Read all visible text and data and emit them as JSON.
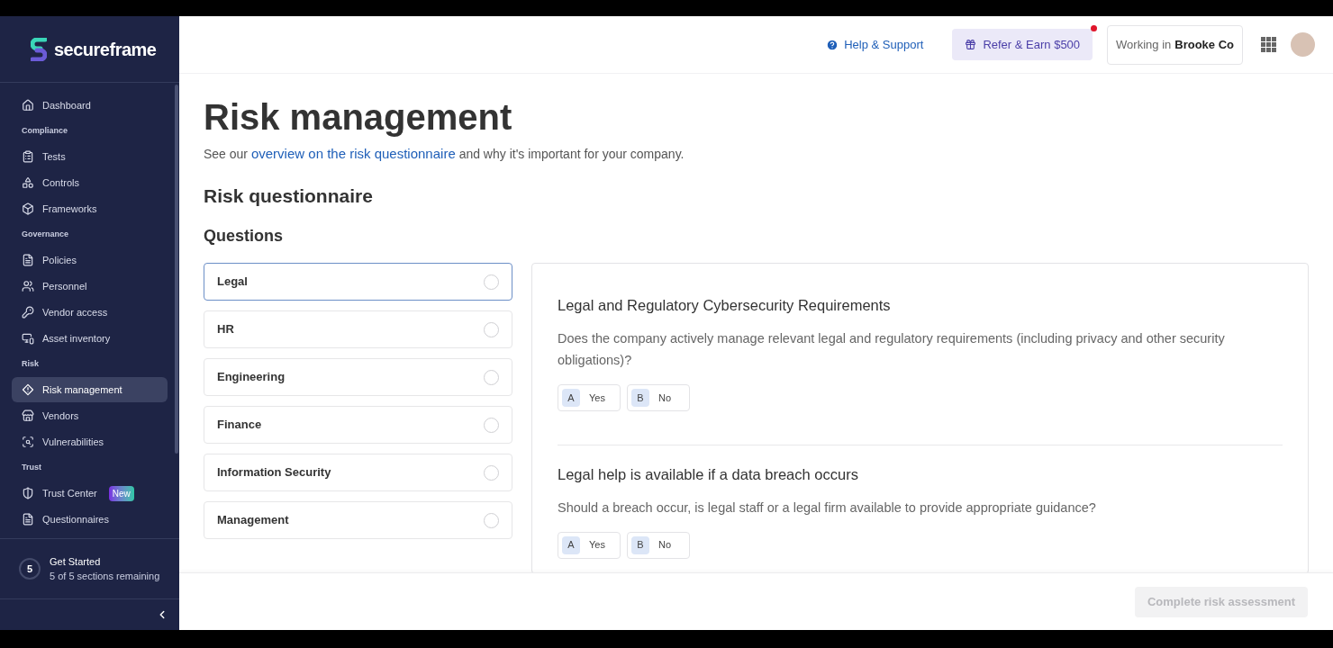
{
  "sidebar": {
    "brand": "secureframe",
    "items": [
      {
        "kind": "item",
        "label": "Dashboard",
        "selected": false
      },
      {
        "kind": "section",
        "label": "Compliance"
      },
      {
        "kind": "item",
        "label": "Tests",
        "selected": false
      },
      {
        "kind": "item",
        "label": "Controls",
        "selected": false
      },
      {
        "kind": "item",
        "label": "Frameworks",
        "selected": false
      },
      {
        "kind": "section",
        "label": "Governance"
      },
      {
        "kind": "item",
        "label": "Policies",
        "selected": false
      },
      {
        "kind": "item",
        "label": "Personnel",
        "selected": false
      },
      {
        "kind": "item",
        "label": "Vendor access",
        "selected": false
      },
      {
        "kind": "item",
        "label": "Asset inventory",
        "selected": false
      },
      {
        "kind": "section",
        "label": "Risk"
      },
      {
        "kind": "item",
        "label": "Risk management",
        "selected": true
      },
      {
        "kind": "item",
        "label": "Vendors",
        "selected": false
      },
      {
        "kind": "item",
        "label": "Vulnerabilities",
        "selected": false
      },
      {
        "kind": "section",
        "label": "Trust"
      },
      {
        "kind": "item",
        "label": "Trust Center",
        "selected": false,
        "badge": "New"
      },
      {
        "kind": "item",
        "label": "Questionnaires",
        "selected": false
      }
    ],
    "get_started": {
      "count": "5",
      "title": "Get Started",
      "subtitle": "5 of 5 sections remaining"
    }
  },
  "header": {
    "help": "Help & Support",
    "refer": "Refer & Earn $500",
    "refer_notification": true,
    "workspace_prefix": "Working in",
    "workspace": "Brooke Co"
  },
  "page": {
    "title": "Risk management",
    "intro_before": "See our",
    "intro_link": "overview on the risk questionnaire",
    "intro_after": "and why it's important for your company.",
    "subtitle": "Risk questionnaire",
    "questions_heading": "Questions"
  },
  "categories": [
    {
      "label": "Legal",
      "selected": true,
      "checked": false
    },
    {
      "label": "HR",
      "selected": false,
      "checked": false
    },
    {
      "label": "Engineering",
      "selected": false,
      "checked": false
    },
    {
      "label": "Finance",
      "selected": false,
      "checked": false
    },
    {
      "label": "Information Security",
      "selected": false,
      "checked": false
    },
    {
      "label": "Management",
      "selected": false,
      "checked": false
    }
  ],
  "questions": [
    {
      "title": "Legal and Regulatory Cybersecurity Requirements",
      "text": "Does the company actively manage relevant legal and regulatory requirements (including privacy and other security obligations)?",
      "options": [
        {
          "key": "A",
          "label": "Yes"
        },
        {
          "key": "B",
          "label": "No"
        }
      ]
    },
    {
      "title": "Legal help is available if a data breach occurs",
      "text": "Should a breach occur, is legal staff or a legal firm available to provide appropriate guidance?",
      "options": [
        {
          "key": "A",
          "label": "Yes"
        },
        {
          "key": "B",
          "label": "No"
        }
      ]
    }
  ],
  "footer": {
    "button": "Complete risk assessment",
    "disabled": true
  }
}
